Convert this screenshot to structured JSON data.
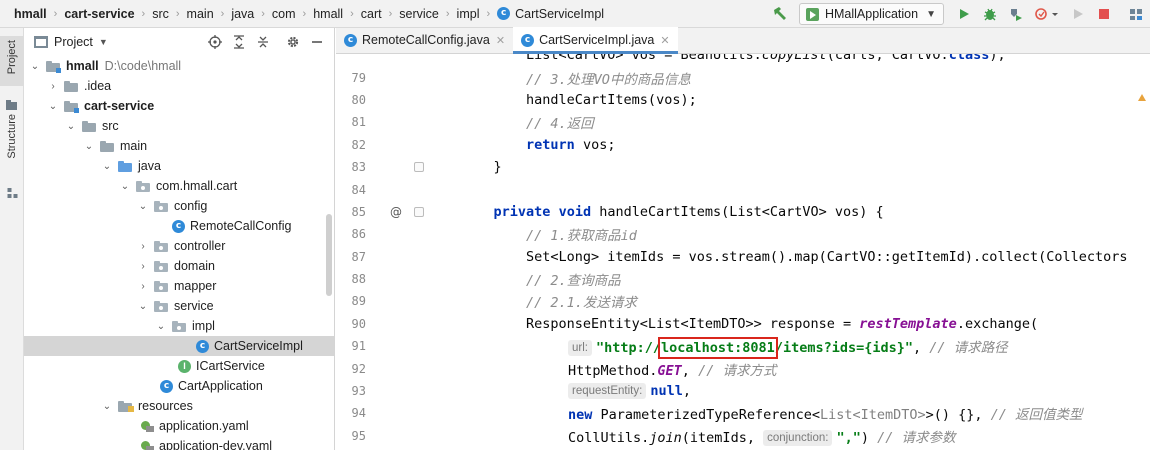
{
  "breadcrumbs": [
    "hmall",
    "cart-service",
    "src",
    "main",
    "java",
    "com",
    "hmall",
    "cart",
    "service",
    "impl",
    "CartServiceImpl"
  ],
  "run_config": {
    "label": "HMallApplication"
  },
  "stripe": {
    "project_label": "Project",
    "structure_label": "Structure"
  },
  "project_panel": {
    "title": "Project",
    "tree": [
      {
        "label": "hmall",
        "hint": "D:\\code\\hmall",
        "expanded": true
      },
      {
        "label": ".idea"
      },
      {
        "label": "cart-service",
        "expanded": true
      },
      {
        "label": "src",
        "expanded": true
      },
      {
        "label": "main",
        "expanded": true
      },
      {
        "label": "java",
        "expanded": true
      },
      {
        "label": "com.hmall.cart",
        "expanded": true
      },
      {
        "label": "config",
        "expanded": true
      },
      {
        "label": "RemoteCallConfig"
      },
      {
        "label": "controller"
      },
      {
        "label": "domain"
      },
      {
        "label": "mapper"
      },
      {
        "label": "service",
        "expanded": true
      },
      {
        "label": "impl",
        "expanded": true
      },
      {
        "label": "CartServiceImpl",
        "selected": true
      },
      {
        "label": "ICartService"
      },
      {
        "label": "CartApplication"
      },
      {
        "label": "resources",
        "expanded": true
      },
      {
        "label": "application.yaml"
      },
      {
        "label": "application-dev.yaml"
      }
    ]
  },
  "editor": {
    "tabs": [
      {
        "label": "RemoteCallConfig.java",
        "active": false
      },
      {
        "label": "CartServiceImpl.java",
        "active": true
      }
    ],
    "line_numbers": [
      "79",
      "80",
      "81",
      "82",
      "83",
      "84",
      "85",
      "86",
      "87",
      "88",
      "89",
      "90",
      "91",
      "92",
      "93",
      "94",
      "95"
    ],
    "code": {
      "l78_a": "        List<CartVO> vos = BeanUtils.",
      "l78_b": "copyList",
      "l78_c": "(carts, CartVO.",
      "l78_d": "class",
      "l78_e": ");",
      "l79": "        // 3.处理VO中的商品信息",
      "l80": "        handleCartItems(vos);",
      "l81": "        // 4.返回",
      "l82_kw": "return",
      "l82_rest": " vos;",
      "l83": "    }",
      "l85_private": "private",
      "l85_void": "void",
      "l85_rest": " handleCartItems(List<CartVO> vos) {",
      "l86": "        // 1.获取商品id",
      "l87": "        Set<Long> itemIds = vos.stream().map(CartVO::getItemId).collect(Collectors",
      "l88": "        // 2.查询商品",
      "l89": "        // 2.1.发送请求",
      "l90_a": "        ResponseEntity<List<ItemDTO>> response = ",
      "l90_b": "restTemplate",
      "l90_c": ".exchange(",
      "l91_hint": "url:",
      "l91_s1": "\"http://",
      "l91_box": "localhost:8081",
      "l91_s2": "/items?ids={ids}\"",
      "l91_rest": ", ",
      "l91_cm": "// 请求路径",
      "l92_a": "HttpMethod.",
      "l92_b": "GET",
      "l92_c": ", ",
      "l92_cm": "// 请求方式",
      "l93_hint": "requestEntity:",
      "l93_null": "null",
      "l93_rest": ",",
      "l94_new": "new",
      "l94_a": " ParameterizedTypeReference<",
      "l94_gen": "List<ItemDTO>",
      "l94_b": ">() {}, ",
      "l94_cm": "// 返回值类型",
      "l95_a": "CollUtils.",
      "l95_b": "join",
      "l95_c": "(itemIds, ",
      "l95_hint": "conjunction:",
      "l95_str": "\",\"",
      "l95_d": ") ",
      "l95_cm": "// 请求参数"
    }
  },
  "colors": {
    "keyword": "#0033b3",
    "comment": "#8c8c8c",
    "string": "#067d17",
    "highlight_box": "#d9261c",
    "selected_row": "#d5d5d5",
    "tab_underline": "#4a88c7"
  }
}
